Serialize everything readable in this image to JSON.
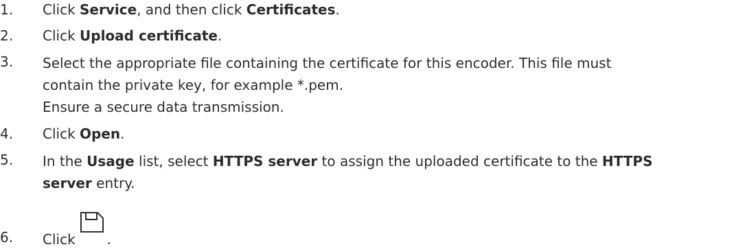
{
  "steps": [
    {
      "number": "1.",
      "pre": "Click ",
      "b1": "Service",
      "mid": ", and then click ",
      "b2": "Certificates",
      "post": "."
    },
    {
      "number": "2.",
      "pre": "Click ",
      "b1": "Upload certificate",
      "post": "."
    },
    {
      "number": "3.",
      "line1": "Select the appropriate file containing the certificate for this encoder. This file must",
      "line2": "contain the private key, for example *.pem.",
      "line3": "Ensure a secure data transmission."
    },
    {
      "number": "4.",
      "pre": "Click ",
      "b1": "Open",
      "post": "."
    },
    {
      "number": "5.",
      "a": "In the ",
      "b_usage": "Usage",
      "c": " list, select ",
      "b_https": "HTTPS server",
      "d": " to assign the uploaded certificate to the ",
      "b_https2a": "HTTPS",
      "b_https2b": "server",
      "e": " entry."
    },
    {
      "number": "6.",
      "pre": "Click",
      "icon": "save-icon",
      "post": "."
    }
  ]
}
